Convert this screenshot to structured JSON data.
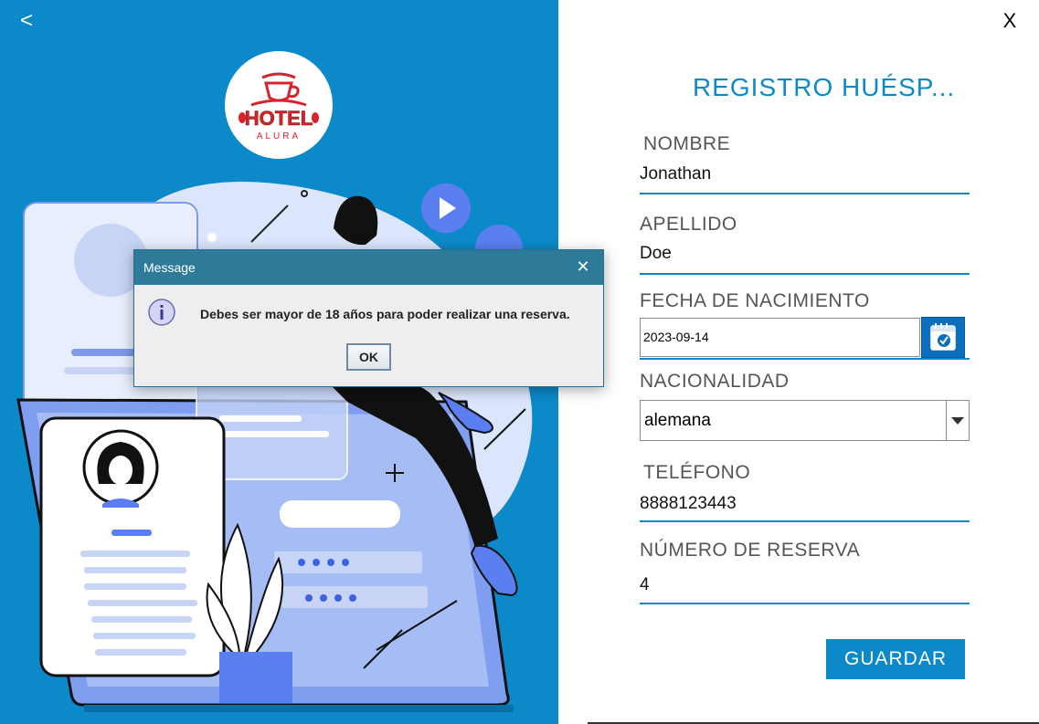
{
  "nav": {
    "back_label": "<",
    "close_label": "X"
  },
  "logo": {
    "text_main": "HOTEL",
    "text_sub": "ALURA"
  },
  "form": {
    "title": "REGISTRO HUÉSP...",
    "nombre_label": "NOMBRE",
    "nombre_value": "Jonathan",
    "apellido_label": "APELLIDO",
    "apellido_value": "Doe",
    "fecha_label": "FECHA DE NACIMIENTO",
    "fecha_value": "2023-09-14",
    "nacionalidad_label": "NACIONALIDAD",
    "nacionalidad_value": "alemana",
    "telefono_label": "TELÉFONO",
    "telefono_value": "8888123443",
    "reserva_label": "NÚMERO DE RESERVA",
    "reserva_value": "4",
    "save_label": "GUARDAR"
  },
  "dialog": {
    "title": "Message",
    "close_label": "✕",
    "message": "Debes ser mayor de 18 años para poder realizar una reserva.",
    "ok_label": "OK"
  },
  "colors": {
    "accent": "#0c89c9",
    "dialog_titlebar": "#2d7a99"
  }
}
